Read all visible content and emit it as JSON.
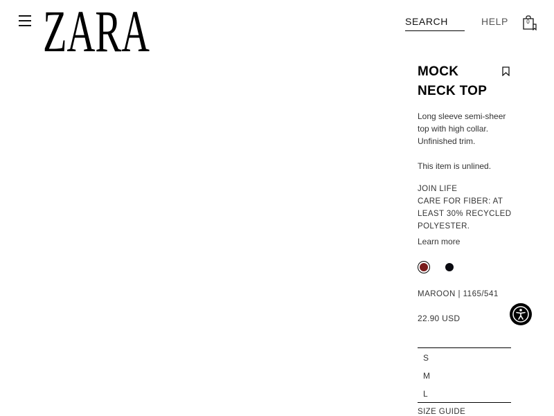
{
  "header": {
    "logo_text": "ZARA",
    "search_label": "SEARCH",
    "help_label": "HELP",
    "cart_count": "0"
  },
  "product": {
    "title": "MOCK NECK TOP",
    "description": "Long sleeve semi-sheer top with high collar. Unfinished trim.",
    "lining_note": "This item is unlined.",
    "join_life_label": "JOIN LIFE",
    "join_life_text": "CARE FOR FIBER: AT LEAST 30% RECYCLED POLYESTER.",
    "learn_more": "Learn more",
    "colors": [
      {
        "name": "maroon",
        "hex": "#7a1c1c",
        "selected": true
      },
      {
        "name": "black",
        "hex": "#0a0a10",
        "selected": false
      }
    ],
    "color_ref": "MAROON | 1165/541",
    "price": "22.90 USD",
    "sizes": [
      "S",
      "M",
      "L"
    ],
    "size_guide": "SIZE GUIDE"
  },
  "icons": {
    "menu": "hamburger-menu-icon",
    "cart": "shopping-bag-icon",
    "bookmark": "bookmark-icon",
    "accessibility": "accessibility-icon"
  }
}
